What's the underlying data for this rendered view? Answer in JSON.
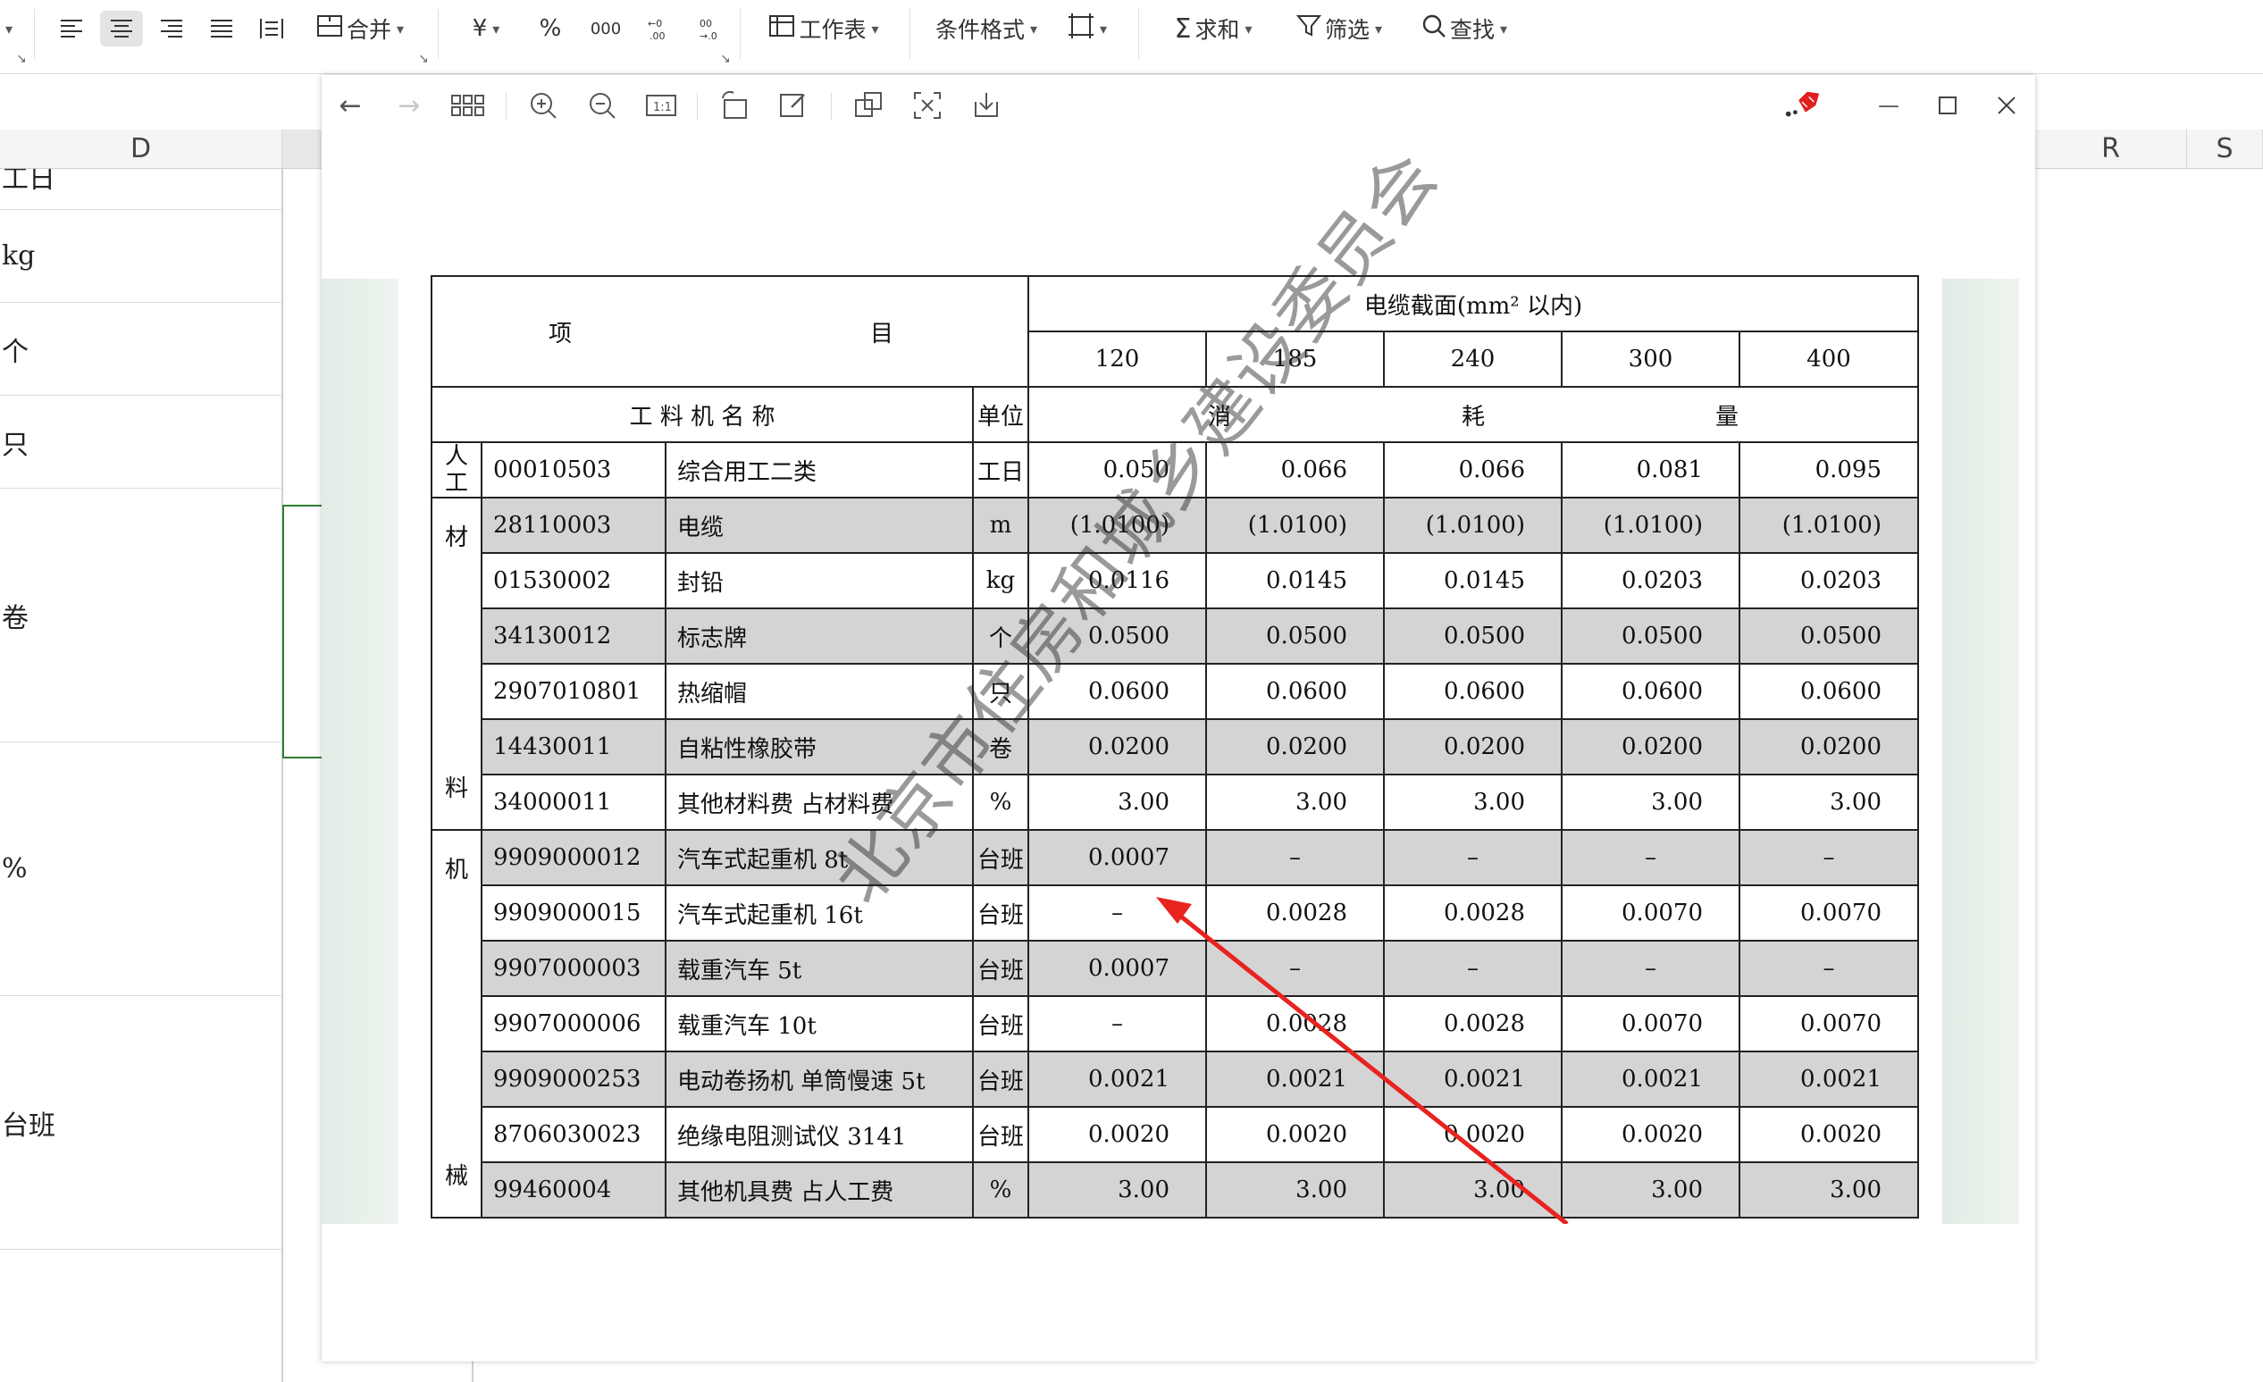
{
  "ribbon": {
    "merge_label": "合并",
    "currency_glyph": "¥",
    "percent_glyph": "%",
    "thousands_glyph": "000",
    "worksheet_label": "工作表",
    "cond_format_label": "条件格式",
    "sum_label": "求和",
    "filter_label": "筛选",
    "find_label": "查找"
  },
  "sheet": {
    "col_d": "D",
    "col_r": "R",
    "col_s": "S",
    "cells": [
      "工日",
      "kg",
      "个",
      "只",
      "卷",
      "%",
      "台班"
    ]
  },
  "table": {
    "header_item_left": "项",
    "header_item_right": "目",
    "cable_header": "电缆截面(mm² 以内)",
    "sizes": [
      "120",
      "185",
      "240",
      "300",
      "400"
    ],
    "name_header": "工 料 机 名 称",
    "unit_header": "单位",
    "consume": [
      "消",
      "耗",
      "量"
    ],
    "group_labor": [
      "人",
      "工"
    ],
    "group_material": [
      "材",
      "料"
    ],
    "group_machine": [
      "机",
      "械"
    ],
    "rows": [
      {
        "code": "00010503",
        "name": "综合用工二类",
        "unit": "工日",
        "vals": [
          "0.050",
          "0.066",
          "0.066",
          "0.081",
          "0.095"
        ]
      },
      {
        "code": "28110003",
        "name": "电缆",
        "unit": "m",
        "vals": [
          "(1.0100)",
          "(1.0100)",
          "(1.0100)",
          "(1.0100)",
          "(1.0100)"
        ]
      },
      {
        "code": "01530002",
        "name": "封铅",
        "unit": "kg",
        "vals": [
          "0.0116",
          "0.0145",
          "0.0145",
          "0.0203",
          "0.0203"
        ]
      },
      {
        "code": "34130012",
        "name": "标志牌",
        "unit": "个",
        "vals": [
          "0.0500",
          "0.0500",
          "0.0500",
          "0.0500",
          "0.0500"
        ]
      },
      {
        "code": "2907010801",
        "name": "热缩帽",
        "unit": "只",
        "vals": [
          "0.0600",
          "0.0600",
          "0.0600",
          "0.0600",
          "0.0600"
        ]
      },
      {
        "code": "14430011",
        "name": "自粘性橡胶带",
        "unit": "卷",
        "vals": [
          "0.0200",
          "0.0200",
          "0.0200",
          "0.0200",
          "0.0200"
        ]
      },
      {
        "code": "34000011",
        "name": "其他材料费 占材料费",
        "unit": "%",
        "vals": [
          "3.00",
          "3.00",
          "3.00",
          "3.00",
          "3.00"
        ]
      },
      {
        "code": "9909000012",
        "name": "汽车式起重机 8t",
        "unit": "台班",
        "vals": [
          "0.0007",
          "–",
          "–",
          "–",
          "–"
        ]
      },
      {
        "code": "9909000015",
        "name": "汽车式起重机 16t",
        "unit": "台班",
        "vals": [
          "–",
          "0.0028",
          "0.0028",
          "0.0070",
          "0.0070"
        ]
      },
      {
        "code": "9907000003",
        "name": "载重汽车 5t",
        "unit": "台班",
        "vals": [
          "0.0007",
          "–",
          "–",
          "–",
          "–"
        ]
      },
      {
        "code": "9907000006",
        "name": "载重汽车 10t",
        "unit": "台班",
        "vals": [
          "–",
          "0.0028",
          "0.0028",
          "0.0070",
          "0.0070"
        ]
      },
      {
        "code": "9909000253",
        "name": "电动卷扬机 单筒慢速 5t",
        "unit": "台班",
        "vals": [
          "0.0021",
          "0.0021",
          "0.0021",
          "0.0021",
          "0.0021"
        ]
      },
      {
        "code": "8706030023",
        "name": "绝缘电阻测试仪 3141",
        "unit": "台班",
        "vals": [
          "0.0020",
          "0.0020",
          "0.0020",
          "0.0020",
          "0.0020"
        ]
      },
      {
        "code": "99460004",
        "name": "其他机具费 占人工费",
        "unit": "%",
        "vals": [
          "3.00",
          "3.00",
          "3.00",
          "3.00",
          "3.00"
        ]
      }
    ]
  },
  "watermark": "北京市住房和城乡建设委员会",
  "colors": {
    "arrow": "#e8231f",
    "shade": "#d4d4d5"
  }
}
